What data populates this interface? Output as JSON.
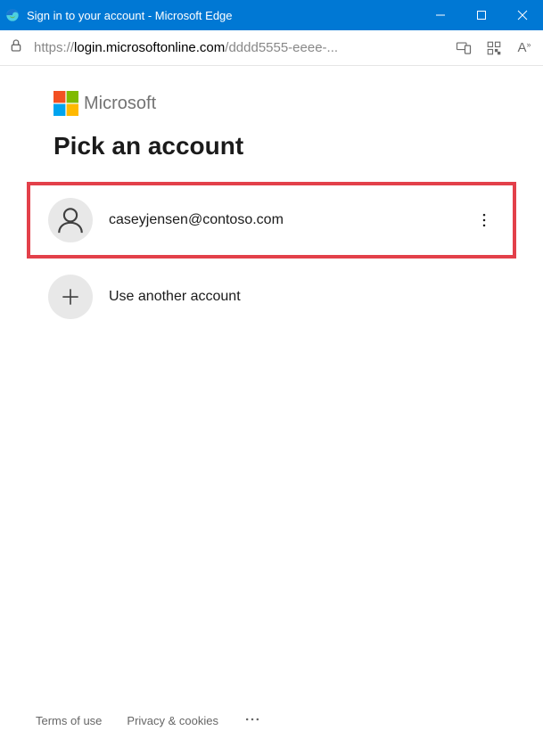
{
  "window": {
    "title": "Sign in to your account - Microsoft Edge"
  },
  "addressbar": {
    "protocol": "https://",
    "domain": "login.microsoftonline.com",
    "path": "/dddd5555-eeee-..."
  },
  "brand": {
    "name": "Microsoft"
  },
  "page": {
    "title": "Pick an account"
  },
  "accounts": [
    {
      "email": "caseyjensen@contoso.com"
    }
  ],
  "actions": {
    "use_another": "Use another account"
  },
  "footer": {
    "terms": "Terms of use",
    "privacy": "Privacy & cookies"
  }
}
